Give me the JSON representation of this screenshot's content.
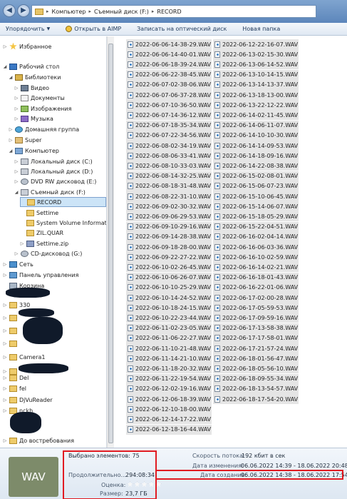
{
  "address": {
    "crumbs": [
      "Компьютер",
      "Съемный диск (F:)",
      "RECORD"
    ]
  },
  "toolbar": {
    "organize": "Упорядочить",
    "open_aimp": "Открыть в AIMP",
    "burn": "Записать на оптический диск",
    "new_folder": "Новая папка"
  },
  "sidebar": {
    "favorites": "Избранное",
    "desktop": "Рабочий стол",
    "libraries": "Библиотеки",
    "video": "Видео",
    "documents": "Документы",
    "images": "Изображения",
    "music": "Музыка",
    "homegroup": "Домашняя группа",
    "super": "Super",
    "computer": "Компьютер",
    "local_c": "Локальный диск (C:)",
    "local_d": "Локальный диск (D:)",
    "dvd_e": "DVD RW дисковод (E:)",
    "removable_f": "Съемный диск (F:)",
    "record": "RECORD",
    "settime": "Settime",
    "svi": "System Volume Information",
    "zil": "ZIL.QUAR",
    "settime_zip": "Settime.zip",
    "cd_g": "CD-дисковод (G:)",
    "network": "Сеть",
    "control_panel": "Панель управления",
    "recycle": "Корзина",
    "f330": "330",
    "camera1": "Camera1",
    "del": "Del",
    "ofel": "fel",
    "djvu": "DjVuReader",
    "nckh": "nckh",
    "later": "До востребования"
  },
  "files_col1": [
    "2022-06-06-14-38-29.WAV",
    "2022-06-06-14-40-01.WAV",
    "2022-06-06-18-39-24.WAV",
    "2022-06-06-22-38-45.WAV",
    "2022-06-07-02-38-06.WAV",
    "2022-06-07-06-37-28.WAV",
    "2022-06-07-10-36-50.WAV",
    "2022-06-07-14-36-12.WAV",
    "2022-06-07-18-35-34.WAV",
    "2022-06-07-22-34-56.WAV",
    "2022-06-08-02-34-19.WAV",
    "2022-06-08-06-33-41.WAV",
    "2022-06-08-10-33-03.WAV",
    "2022-06-08-14-32-25.WAV",
    "2022-06-08-18-31-48.WAV",
    "2022-06-08-22-31-10.WAV",
    "2022-06-09-02-30-32.WAV",
    "2022-06-09-06-29-53.WAV",
    "2022-06-09-10-29-16.WAV",
    "2022-06-09-14-28-38.WAV",
    "2022-06-09-18-28-00.WAV",
    "2022-06-09-22-27-22.WAV",
    "2022-06-10-02-26-45.WAV",
    "2022-06-10-06-26-07.WAV",
    "2022-06-10-10-25-29.WAV",
    "2022-06-10-14-24-52.WAV",
    "2022-06-10-18-24-15.WAV",
    "2022-06-10-22-23-44.WAV",
    "2022-06-11-02-23-05.WAV",
    "2022-06-11-06-22-27.WAV",
    "2022-06-11-10-21-48.WAV",
    "2022-06-11-14-21-10.WAV",
    "2022-06-11-18-20-32.WAV",
    "2022-06-11-22-19-54.WAV",
    "2022-06-12-02-19-16.WAV",
    "2022-06-12-06-18-39.WAV",
    "2022-06-12-10-18-00.WAV",
    "2022-06-12-14-17-22.WAV",
    "2022-06-12-18-16-44.WAV"
  ],
  "files_col2": [
    "2022-06-12-22-16-07.WAV",
    "2022-06-13-02-15-30.WAV",
    "2022-06-13-06-14-52.WAV",
    "2022-06-13-10-14-15.WAV",
    "2022-06-13-14-13-37.WAV",
    "2022-06-13-18-13-00.WAV",
    "2022-06-13-22-12-22.WAV",
    "2022-06-14-02-11-45.WAV",
    "2022-06-14-06-11-07.WAV",
    "2022-06-14-10-10-30.WAV",
    "2022-06-14-14-09-53.WAV",
    "2022-06-14-18-09-16.WAV",
    "2022-06-14-22-08-38.WAV",
    "2022-06-15-02-08-01.WAV",
    "2022-06-15-06-07-23.WAV",
    "2022-06-15-10-06-45.WAV",
    "2022-06-15-14-06-07.WAV",
    "2022-06-15-18-05-29.WAV",
    "2022-06-15-22-04-51.WAV",
    "2022-06-16-02-04-14.WAV",
    "2022-06-16-06-03-36.WAV",
    "2022-06-16-10-02-59.WAV",
    "2022-06-16-14-02-21.WAV",
    "2022-06-16-18-01-43.WAV",
    "2022-06-16-22-01-06.WAV",
    "2022-06-17-02-00-28.WAV",
    "2022-06-17-05-59-53.WAV",
    "2022-06-17-09-59-16.WAV",
    "2022-06-17-13-58-38.WAV",
    "2022-06-17-17-58-01.WAV",
    "2022-06-17-21-57-24.WAV",
    "2022-06-18-01-56-47.WAV",
    "2022-06-18-05-56-10.WAV",
    "2022-06-18-09-55-34.WAV",
    "2022-06-18-13-54-57.WAV",
    "2022-06-18-17-54-20.WAV"
  ],
  "details": {
    "thumb": "WAV",
    "selected_label": "Выбрано элементов:",
    "selected_value": "75",
    "duration_label": "Продолжительно...",
    "duration_value": "294:08:34",
    "rating_label": "Оценка:",
    "size_label": "Размер:",
    "size_value": "23,7 ГБ",
    "bitrate_label": "Скорость потока:",
    "bitrate_value": "192 кбит в сек",
    "modified_label": "Дата изменения:",
    "modified_value": "06.06.2022 14:39 - 18.06.2022 20:48",
    "created_label": "Дата создания:",
    "created_value": "06.06.2022 14:38 - 18.06.2022 17:54"
  }
}
